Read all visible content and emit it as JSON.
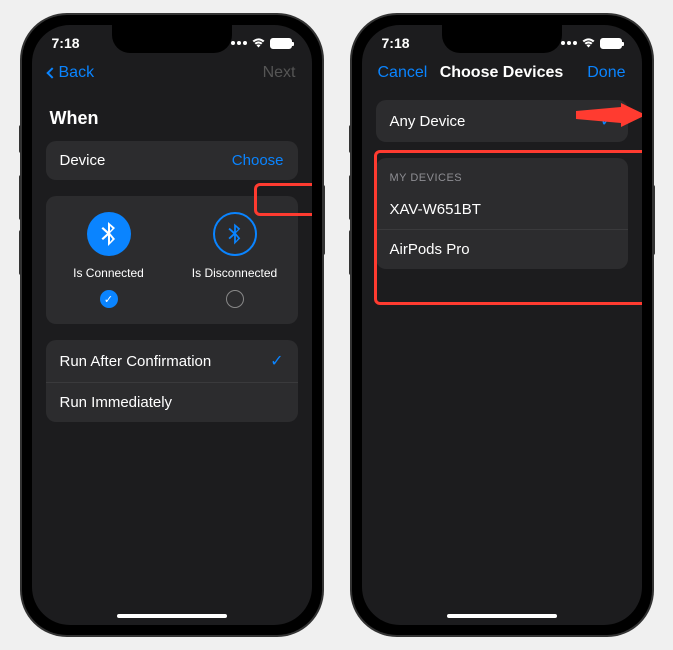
{
  "status": {
    "time": "7:18"
  },
  "left_screen": {
    "nav": {
      "back": "Back",
      "next": "Next"
    },
    "title": "When",
    "device_row": {
      "label": "Device",
      "action": "Choose"
    },
    "options": {
      "connected": "Is Connected",
      "disconnected": "Is Disconnected"
    },
    "run_options": {
      "after_confirm": "Run After Confirmation",
      "immediately": "Run Immediately"
    }
  },
  "right_screen": {
    "nav": {
      "cancel": "Cancel",
      "title": "Choose Devices",
      "done": "Done"
    },
    "any_device": "Any Device",
    "section_header": "MY DEVICES",
    "devices": [
      "XAV-W651BT",
      "AirPods Pro"
    ]
  }
}
